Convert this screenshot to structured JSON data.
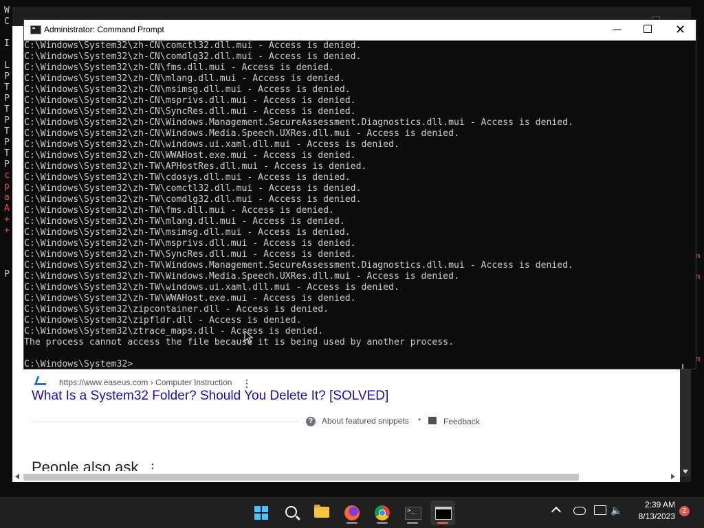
{
  "background_terminal": {
    "letters": [
      {
        "t": "W",
        "c": "#cccccc"
      },
      {
        "t": "C",
        "c": "#cccccc"
      },
      {
        "t": "",
        "c": "#cccccc"
      },
      {
        "t": "I",
        "c": "#cccccc"
      },
      {
        "t": "",
        "c": "#cccccc"
      },
      {
        "t": "L",
        "c": "#cccccc"
      },
      {
        "t": "P",
        "c": "#cccccc"
      },
      {
        "t": "T",
        "c": "#cccccc"
      },
      {
        "t": "P",
        "c": "#cccccc"
      },
      {
        "t": "T",
        "c": "#cccccc"
      },
      {
        "t": "P",
        "c": "#cccccc"
      },
      {
        "t": "T",
        "c": "#cccccc"
      },
      {
        "t": "P",
        "c": "#cccccc"
      },
      {
        "t": "T",
        "c": "#cccccc"
      },
      {
        "t": "P",
        "c": "#cccccc"
      },
      {
        "t": "c",
        "c": "#d9534f"
      },
      {
        "t": "p",
        "c": "#d9534f"
      },
      {
        "t": "a",
        "c": "#d9534f"
      },
      {
        "t": "A",
        "c": "#d9534f"
      },
      {
        "t": "+",
        "c": "#d9534f"
      },
      {
        "t": "+",
        "c": "#d9534f"
      },
      {
        "t": "",
        "c": "#cccccc"
      },
      {
        "t": "",
        "c": "#cccccc"
      },
      {
        "t": "",
        "c": "#cccccc"
      },
      {
        "t": "P",
        "c": "#cccccc"
      }
    ]
  },
  "browser": {
    "result": {
      "url": "https://www.easeus.com › Computer Instruction",
      "title": "What Is a System32 Folder? Should You Delete It? [SOLVED]"
    },
    "snippet_footer": {
      "about": "About featured snippets",
      "separator": "•",
      "feedback": "Feedback"
    },
    "people_also_ask": "People also ask"
  },
  "cmd_window": {
    "title": "Administrator: Command Prompt",
    "lines": [
      "C:\\Windows\\System32\\zh-CN\\comctl32.dll.mui - Access is denied.",
      "C:\\Windows\\System32\\zh-CN\\comdlg32.dll.mui - Access is denied.",
      "C:\\Windows\\System32\\zh-CN\\fms.dll.mui - Access is denied.",
      "C:\\Windows\\System32\\zh-CN\\mlang.dll.mui - Access is denied.",
      "C:\\Windows\\System32\\zh-CN\\msimsg.dll.mui - Access is denied.",
      "C:\\Windows\\System32\\zh-CN\\msprivs.dll.mui - Access is denied.",
      "C:\\Windows\\System32\\zh-CN\\SyncRes.dll.mui - Access is denied.",
      "C:\\Windows\\System32\\zh-CN\\Windows.Management.SecureAssessment.Diagnostics.dll.mui - Access is denied.",
      "C:\\Windows\\System32\\zh-CN\\Windows.Media.Speech.UXRes.dll.mui - Access is denied.",
      "C:\\Windows\\System32\\zh-CN\\windows.ui.xaml.dll.mui - Access is denied.",
      "C:\\Windows\\System32\\zh-CN\\WWAHost.exe.mui - Access is denied.",
      "C:\\Windows\\System32\\zh-TW\\APHostRes.dll.mui - Access is denied.",
      "C:\\Windows\\System32\\zh-TW\\cdosys.dll.mui - Access is denied.",
      "C:\\Windows\\System32\\zh-TW\\comctl32.dll.mui - Access is denied.",
      "C:\\Windows\\System32\\zh-TW\\comdlg32.dll.mui - Access is denied.",
      "C:\\Windows\\System32\\zh-TW\\fms.dll.mui - Access is denied.",
      "C:\\Windows\\System32\\zh-TW\\mlang.dll.mui - Access is denied.",
      "C:\\Windows\\System32\\zh-TW\\msimsg.dll.mui - Access is denied.",
      "C:\\Windows\\System32\\zh-TW\\msprivs.dll.mui - Access is denied.",
      "C:\\Windows\\System32\\zh-TW\\SyncRes.dll.mui - Access is denied.",
      "C:\\Windows\\System32\\zh-TW\\Windows.Management.SecureAssessment.Diagnostics.dll.mui - Access is denied.",
      "C:\\Windows\\System32\\zh-TW\\Windows.Media.Speech.UXRes.dll.mui - Access is denied.",
      "C:\\Windows\\System32\\zh-TW\\windows.ui.xaml.dll.mui - Access is denied.",
      "C:\\Windows\\System32\\zh-TW\\WWAHost.exe.mui - Access is denied.",
      "C:\\Windows\\System32\\zipcontainer.dll - Access is denied.",
      "C:\\Windows\\System32\\zipfldr.dll - Access is denied.",
      "C:\\Windows\\System32\\ztrace_maps.dll - Access is denied.",
      "The process cannot access the file because it is being used by another process.",
      "",
      "C:\\Windows\\System32>"
    ]
  },
  "taskbar": {
    "apps": [
      {
        "name": "start-button",
        "icon": "windows-start-icon"
      },
      {
        "name": "search-button",
        "icon": "search-icon"
      },
      {
        "name": "file-explorer-button",
        "icon": "folder-icon"
      },
      {
        "name": "firefox-button",
        "icon": "firefox-icon"
      },
      {
        "name": "chrome-button",
        "icon": "chrome-icon"
      },
      {
        "name": "terminal-button",
        "icon": "terminal-icon"
      },
      {
        "name": "command-prompt-button",
        "icon": "cmd-icon"
      }
    ],
    "clock": {
      "time": "2:39 AM",
      "date": "8/13/2023"
    },
    "notification_count": "2"
  },
  "colors": {
    "accent_indicator": "#e05a4f",
    "link": "#1a0dab",
    "start_blue": "#4cc2ff"
  }
}
